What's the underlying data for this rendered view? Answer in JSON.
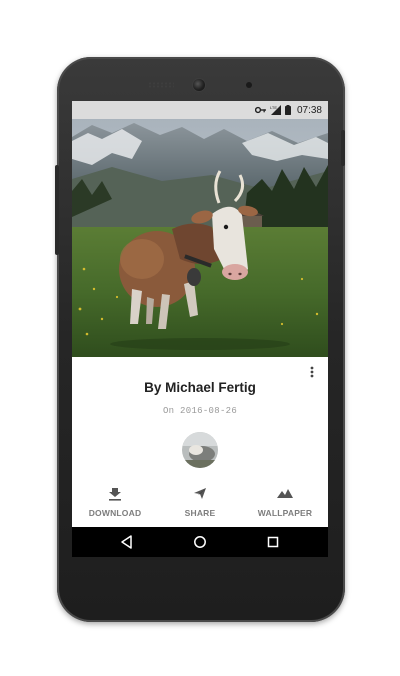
{
  "status_bar": {
    "time": "07:38",
    "icons": [
      "key-icon",
      "lte-signal-icon",
      "battery-icon"
    ]
  },
  "photo": {
    "subject": "cow-in-alpine-meadow"
  },
  "card": {
    "author": "By Michael Fertig",
    "date": "On 2016-08-26"
  },
  "actions": [
    {
      "label": "DOWNLOAD",
      "icon": "download-icon"
    },
    {
      "label": "SHARE",
      "icon": "share-icon"
    },
    {
      "label": "WALLPAPER",
      "icon": "wallpaper-icon"
    }
  ],
  "nav": {
    "buttons": [
      "back-icon",
      "home-icon",
      "recents-icon"
    ]
  },
  "colors": {
    "status_bar": "#dcdcdc",
    "nav_bar": "#000000",
    "action_label": "#7d7d7d"
  }
}
